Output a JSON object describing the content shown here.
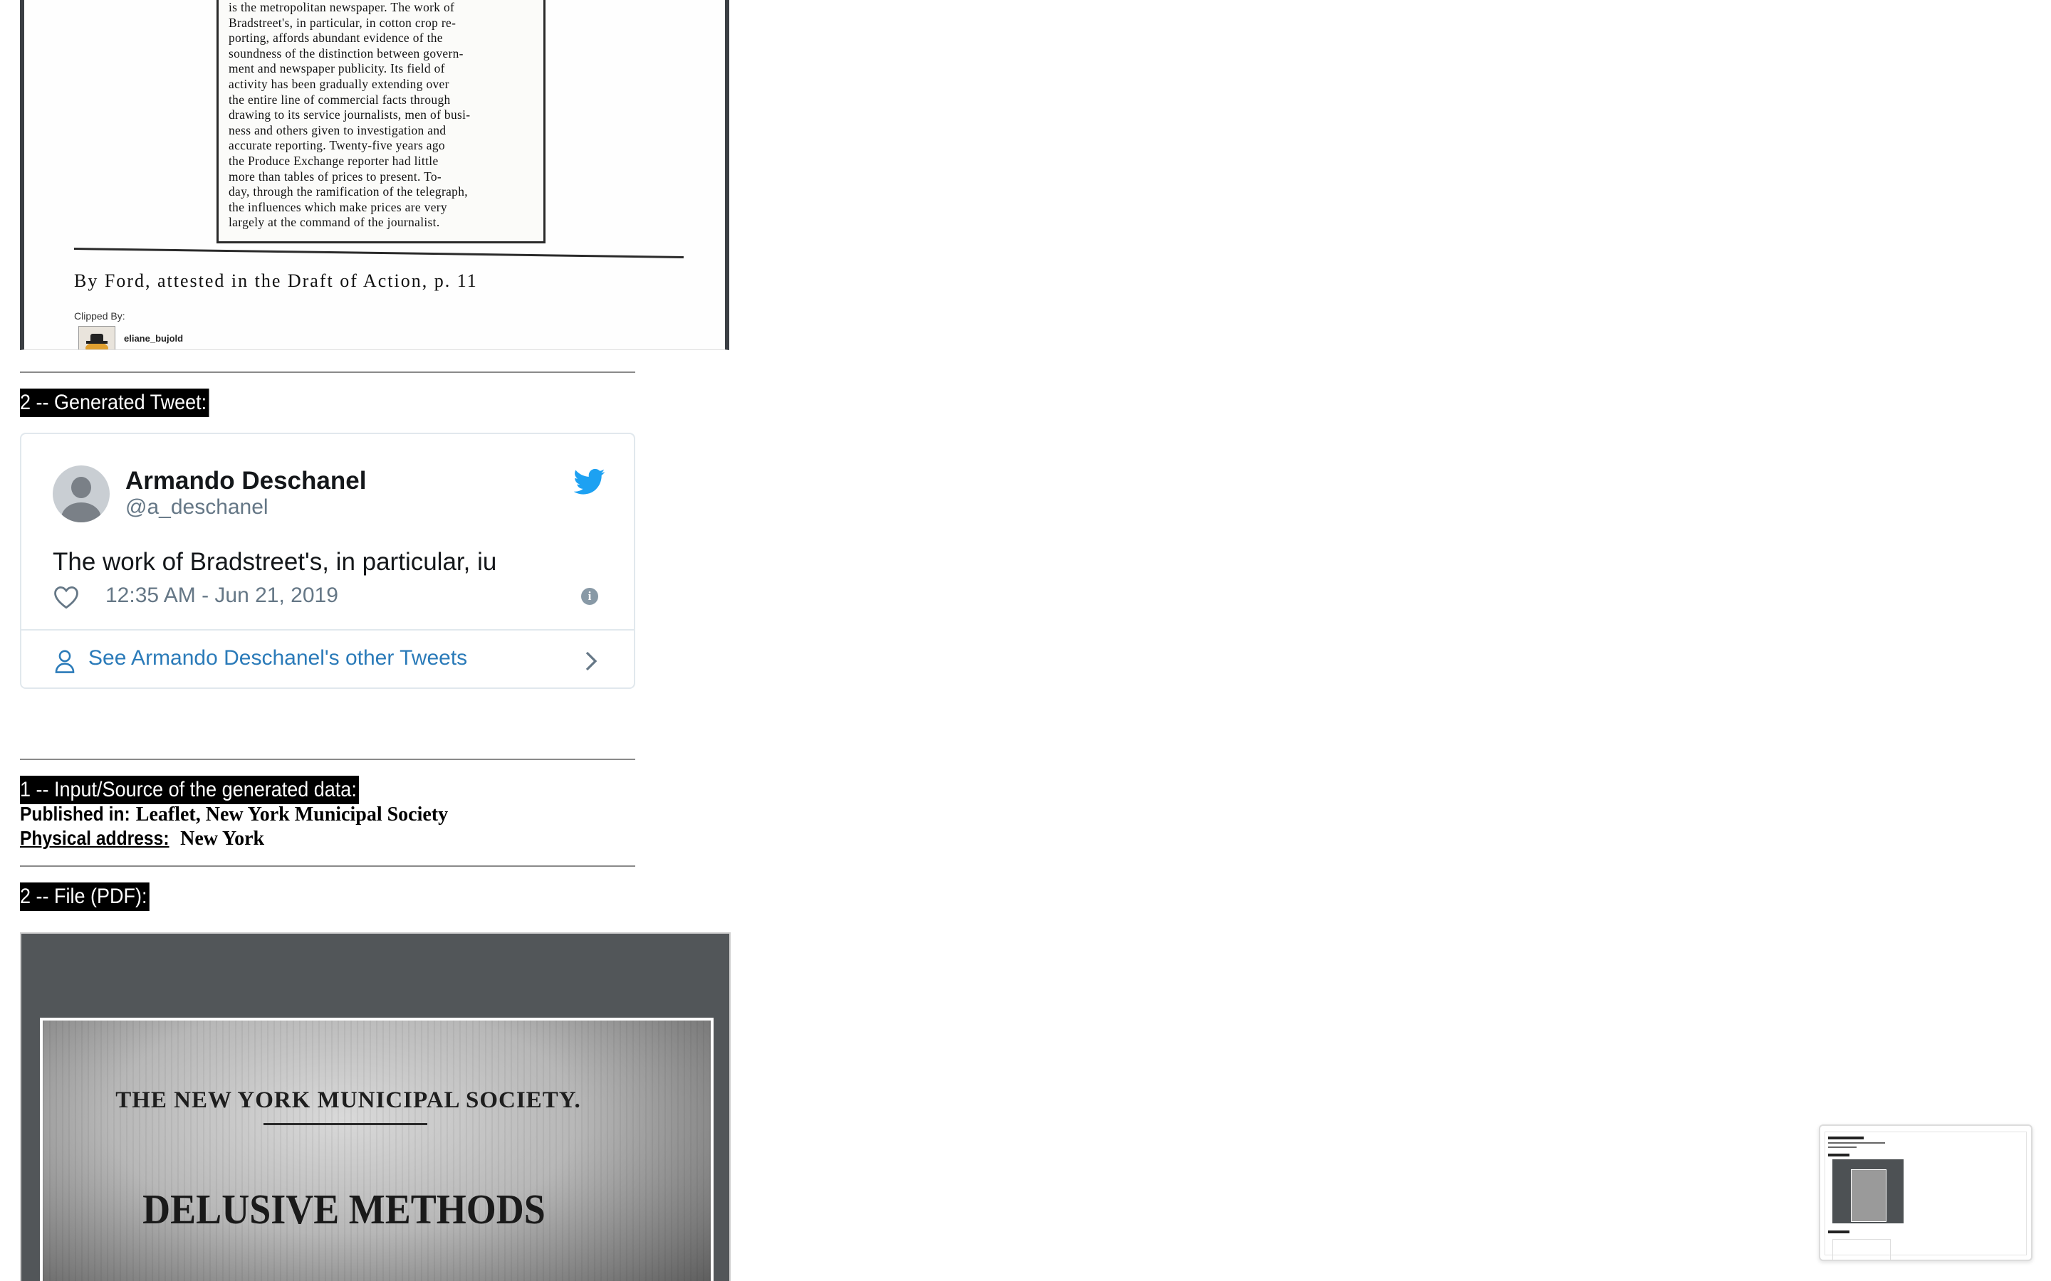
{
  "clipping": {
    "lines": [
      "is the metropolitan newspaper.  The work of",
      "Bradstreet's, in particular, in cotton crop re-",
      "porting, affords abundant evidence of the",
      "soundness of the distinction between govern-",
      "ment and newspaper publicity.  Its field of",
      "activity has been gradually extending over",
      "the entire line of commercial facts through",
      "drawing to its service journalists, men of busi-",
      "ness and others given to investigation and",
      "accurate reporting.  Twenty-five years ago",
      "the Produce Exchange reporter had little",
      "more than tables of prices to present.  To-",
      "day, through the ramification of the telegraph,",
      "the influences which make prices are very",
      "largely at the command of the journalist."
    ],
    "caption": "By Ford, attested in the Draft of Action, p. 11",
    "clipped_by_label": "Clipped By:",
    "clipped_by_user": "eliane_bujold"
  },
  "section_tweet_label": "2 -- Generated Tweet:",
  "tweet": {
    "name": "Armando Deschanel",
    "handle": "@a_deschanel",
    "text": "The work of Bradstreet's, in particular, iu",
    "time": "12:35 AM - Jun 21, 2019",
    "see_more": "See Armando Deschanel's other Tweets",
    "brand_color": "#1da1f2",
    "link_color": "#2b7bb9"
  },
  "section_source_label": "1 -- Input/Source of the generated data:",
  "source": {
    "published_label": "Published in:",
    "published_value": "Leaflet, New York Municipal Society",
    "address_label": "Physical address:",
    "address_value": "New York"
  },
  "section_file_label": "2 -- File (PDF):",
  "pdf": {
    "heading": "THE NEW YORK MUNICIPAL SOCIETY.",
    "title": "DELUSIVE METHODS"
  }
}
